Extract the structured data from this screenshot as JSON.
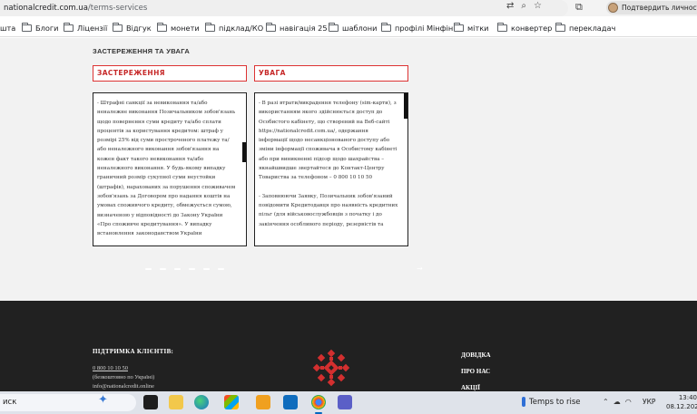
{
  "browser": {
    "url_host": "nationalcredit.com.ua",
    "url_path": "/terms-services",
    "profile_label": "Подтвердить личность"
  },
  "bookmarks": [
    {
      "label": "шта",
      "folder": false
    },
    {
      "label": "Блоги",
      "folder": true
    },
    {
      "label": "Ліцензії",
      "folder": true
    },
    {
      "label": "Відгук",
      "folder": true
    },
    {
      "label": "монети",
      "folder": true
    },
    {
      "label": "підклад/КО",
      "folder": true
    },
    {
      "label": "навігація 25",
      "folder": true
    },
    {
      "label": "шаблони",
      "folder": true
    },
    {
      "label": "профілі Мінфін",
      "folder": true
    },
    {
      "label": "мітки",
      "folder": true
    },
    {
      "label": "конвертер",
      "folder": true
    },
    {
      "label": "перекладач",
      "folder": true
    }
  ],
  "content": {
    "section_label": "ЗАСТЕРЕЖЕННЯ ТА УВАГА",
    "left_header": "ЗАСТЕРЕЖЕННЯ",
    "right_header": "УВАГА",
    "left_text": [
      "- Штрафні санкції за невиконання та/або неналежне виконання Позичальником зобов'язань щодо повернення суми кредиту та/або сплати процентів за користування кредитом: штраф у розмірі 25% від суми простроченого платежу та/або неналежного виконання зобов'язання на кожен факт такого невиконання та/або неналежного виконання. У будь-якому випадку граничний розмір сукупної суми неустойки (штрафів), нарахованих за порушення споживачем зобов'язань за Договором про надання коштів на умовах споживчого кредиту, обмежується сумою, визначеною у відповідності до Закону України «Про споживче кредитування». У випадку встановлення законодавством України"
    ],
    "right_text": [
      "- В разі втрати/викрадення телефону (sim-карти), з використанням якого здійснюється доступ до Особистого кабінету, що створений на Веб-сайті https://nationalcredit.com.ua/, одержання інформації щодо несанкціонованого доступу або зміни інформації споживача в Особистому кабінеті або при виникненні підозр щодо шахрайства – якнайшвидше звертайтеся до Контакт-Центру Товариства за телефоном – 0 800 10 10 50",
      "- Заповнюючи Заявку, Позичальник зобов'язаний повідомити Кредитодавця про наявність кредитних пільг (для військовослужбовців з початку і до закінчення особливого періоду, резервістів та"
    ]
  },
  "footer": {
    "support_title": "ПІДТРИМКА КЛІЄНТІВ:",
    "phone": "0 800 10 10 50",
    "phone_note": "(безкоштовно по Україні)",
    "email": "info@nationalcredit.online",
    "links": [
      "ДОВІДКА",
      "ПРО НАС",
      "АКЦІЇ"
    ]
  },
  "taskbar": {
    "search_label": "иск",
    "weather_text": "Temps to rise",
    "language": "УКР",
    "time": "13:40",
    "date": "08.12.2025"
  },
  "colors": {
    "accent_red": "#c62828",
    "footer_bg": "#212121",
    "page_bg": "#f2f2f2"
  }
}
